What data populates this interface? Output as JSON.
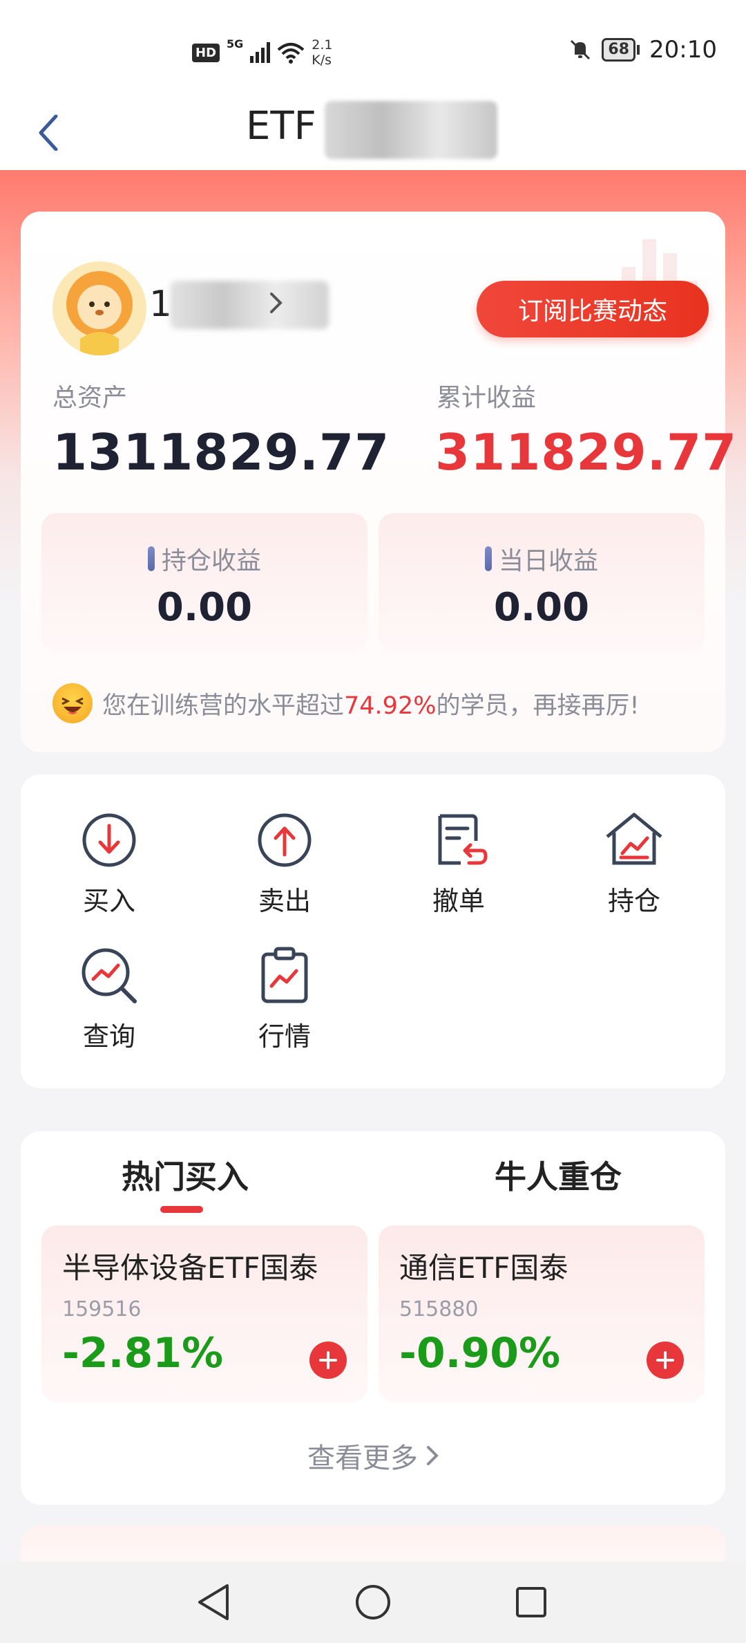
{
  "status_bar": {
    "hd": "HD",
    "network": "5G",
    "speed_value": "2.1",
    "speed_unit": "K/s",
    "battery": "68",
    "time": "20:10"
  },
  "nav": {
    "title": "ETF"
  },
  "account": {
    "username": "17",
    "subscribe_label": "订阅比赛动态",
    "total_assets_label": "总资产",
    "total_assets_value": "1311829.77",
    "cumulative_label": "累计收益",
    "cumulative_value": "311829.77",
    "holding_label": "持仓收益",
    "holding_value": "0.00",
    "daily_label": "当日收益",
    "daily_value": "0.00",
    "rank_prefix": "您在训练营的水平超过",
    "rank_percent": "74.92%",
    "rank_suffix": "的学员，再接再厉!"
  },
  "actions": [
    {
      "label": "买入",
      "icon": "buy-icon"
    },
    {
      "label": "卖出",
      "icon": "sell-icon"
    },
    {
      "label": "撤单",
      "icon": "cancel-order-icon"
    },
    {
      "label": "持仓",
      "icon": "holdings-icon"
    },
    {
      "label": "查询",
      "icon": "query-icon"
    },
    {
      "label": "行情",
      "icon": "market-icon"
    }
  ],
  "hot": {
    "tab_hot": "热门买入",
    "tab_bull": "牛人重仓",
    "funds": [
      {
        "name": "半导体设备ETF国泰",
        "code": "159516",
        "change": "-2.81%"
      },
      {
        "name": "通信ETF国泰",
        "code": "515880",
        "change": "-0.90%"
      }
    ],
    "more_label": "查看更多"
  },
  "colors": {
    "accent_red": "#e8373a",
    "negative_green": "#1a9b1a",
    "muted_text": "#8a8d98"
  }
}
